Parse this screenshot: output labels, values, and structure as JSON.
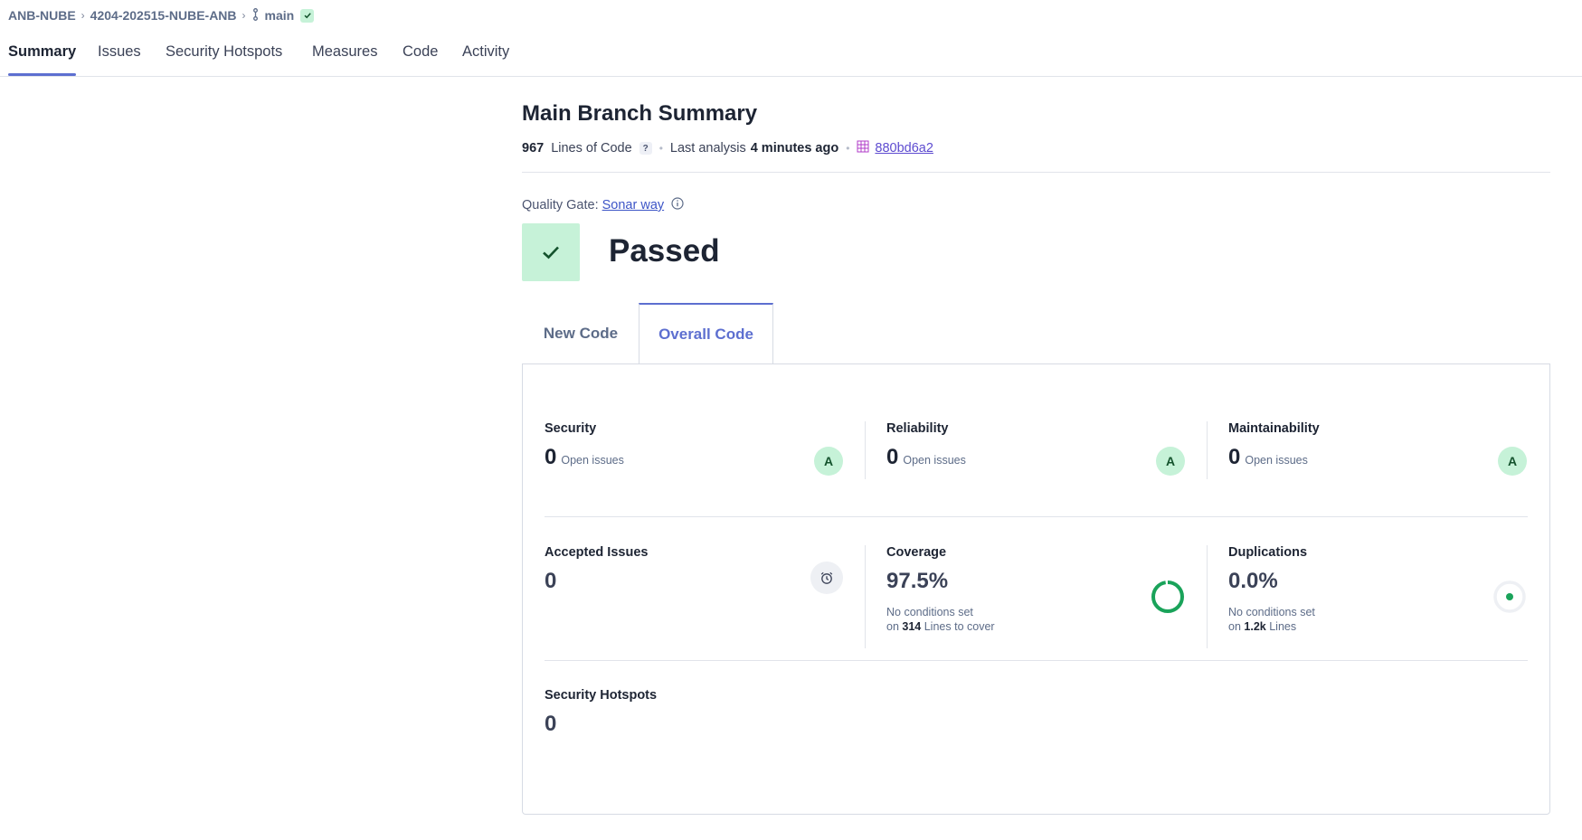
{
  "breadcrumb": {
    "org": "ANB-NUBE",
    "project": "4204-202515-NUBE-ANB",
    "branch": "main"
  },
  "nav": {
    "items": [
      {
        "label": "Summary",
        "active": true
      },
      {
        "label": "Issues",
        "active": false
      },
      {
        "label": "Security Hotspots",
        "active": false
      },
      {
        "label": "Measures",
        "active": false
      },
      {
        "label": "Code",
        "active": false
      },
      {
        "label": "Activity",
        "active": false
      }
    ]
  },
  "summary": {
    "title": "Main Branch Summary",
    "loc_value": "967",
    "loc_label": "Lines of Code",
    "help_glyph": "?",
    "last_analysis_label": "Last analysis",
    "last_analysis_value": "4 minutes ago",
    "commit": "880bd6a2"
  },
  "quality_gate": {
    "label": "Quality Gate:",
    "link": "Sonar way",
    "status": "Passed"
  },
  "code_tabs": {
    "new_code": "New Code",
    "overall_code": "Overall Code"
  },
  "metrics": {
    "security": {
      "title": "Security",
      "value": "0",
      "sub": "Open issues",
      "rating": "A"
    },
    "reliability": {
      "title": "Reliability",
      "value": "0",
      "sub": "Open issues",
      "rating": "A"
    },
    "maintainability": {
      "title": "Maintainability",
      "value": "0",
      "sub": "Open issues",
      "rating": "A"
    },
    "accepted_issues": {
      "title": "Accepted Issues",
      "value": "0"
    },
    "coverage": {
      "title": "Coverage",
      "value": "97.5%",
      "coverage_fraction": 0.975,
      "note_line1": "No conditions set",
      "note_on": "on",
      "note_count": "314",
      "note_tail": "Lines to cover"
    },
    "duplications": {
      "title": "Duplications",
      "value": "0.0%",
      "note_line1": "No conditions set",
      "note_on": "on",
      "note_count": "1.2k",
      "note_tail": "Lines"
    },
    "security_hotspots": {
      "title": "Security Hotspots",
      "value": "0"
    }
  },
  "colors": {
    "accent": "#5d6fd0",
    "pass_bg": "#c6f2d8",
    "pass_fg": "#14532d",
    "coverage_ring": "#1aa35a"
  },
  "icons": {
    "branch": "branch-icon",
    "check": "check-icon",
    "info": "info-icon",
    "commit": "commit-grid-icon",
    "accepted": "alarm-clock-icon",
    "duplication": "duplication-dot-icon"
  }
}
